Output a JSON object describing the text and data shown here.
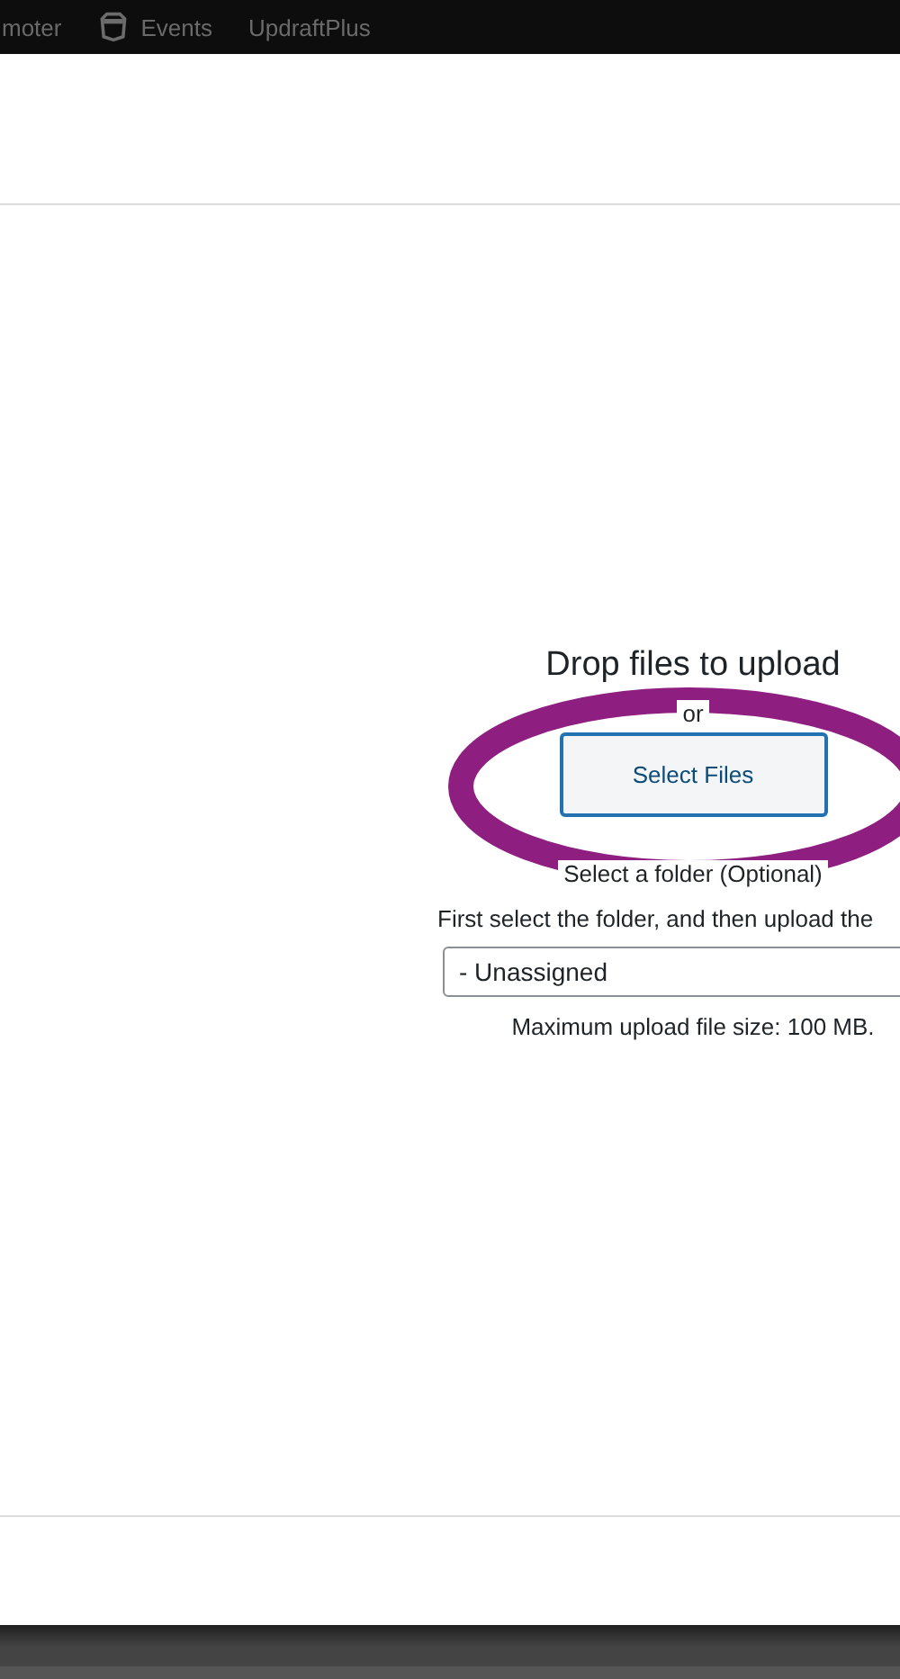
{
  "admin_bar": {
    "items": [
      {
        "label": "moter",
        "kind": "text"
      },
      {
        "label": "Events",
        "kind": "icon"
      },
      {
        "label": "UpdraftPlus",
        "kind": "text"
      }
    ]
  },
  "uploader": {
    "title": "Drop files to upload",
    "or": "or",
    "button": "Select Files",
    "folder_label": "Select a folder (Optional)",
    "folder_hint": "First select the folder, and then upload the",
    "folder_value": "- Unassigned",
    "max_size": "Maximum upload file size: 100 MB."
  }
}
